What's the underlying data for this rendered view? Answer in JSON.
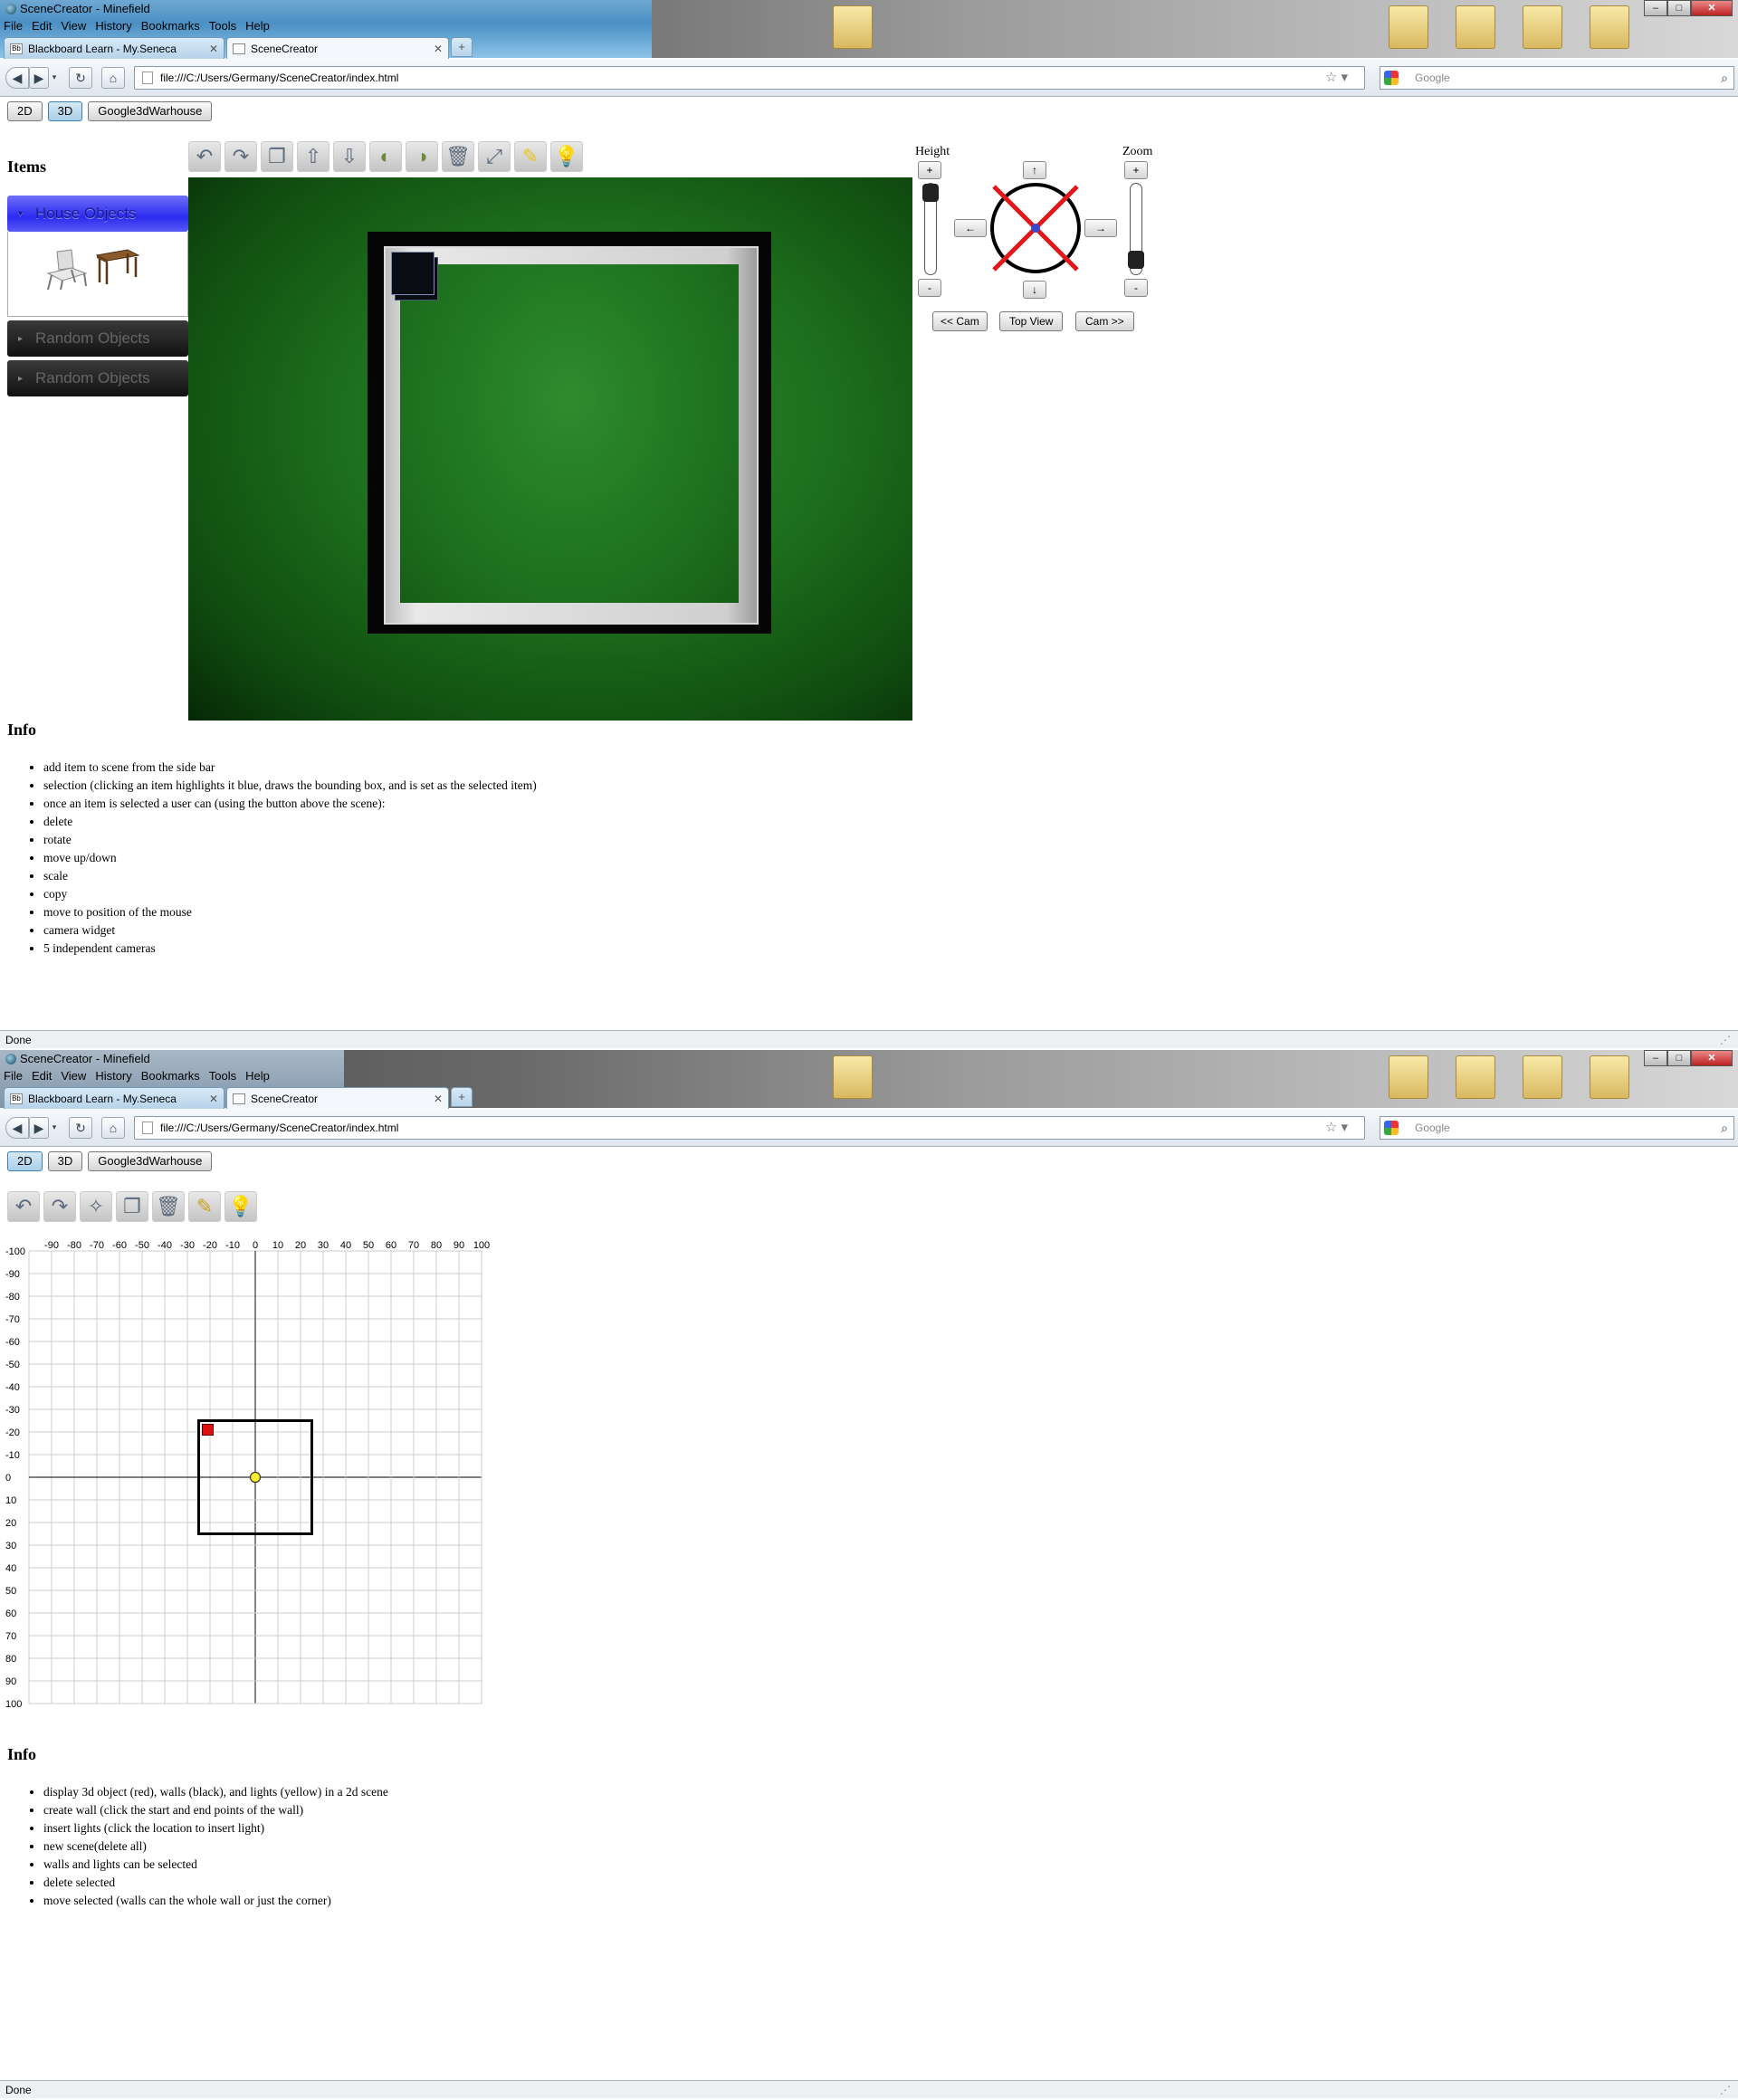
{
  "window1": {
    "app_title": "SceneCreator - Minefield",
    "menu": [
      "File",
      "Edit",
      "View",
      "History",
      "Bookmarks",
      "Tools",
      "Help"
    ],
    "tabs": [
      {
        "label": "Blackboard Learn - My.Seneca",
        "icon": "Bb"
      },
      {
        "label": "SceneCreator"
      }
    ],
    "new_tab": "+",
    "url": "file:///C:/Users/Germany/SceneCreator/index.html",
    "search_placeholder": "Google",
    "status": "Done",
    "buttons": {
      "b2d": "2D",
      "b3d": "3D",
      "warehouse": "Google3dWarhouse",
      "active": "3D"
    },
    "items_heading": "Items",
    "accordion": [
      {
        "label": "House Objects",
        "state": "open",
        "arrow": "▾"
      },
      {
        "label": "Random Objects",
        "state": "closed",
        "arrow": "▸"
      },
      {
        "label": "Random Objects",
        "state": "closed",
        "arrow": "▸"
      }
    ],
    "toolbar_icons": [
      "undo-icon",
      "redo-icon",
      "copy-icon",
      "move-up-icon",
      "move-down-icon",
      "rotate-left-icon",
      "rotate-right-icon",
      "delete-icon",
      "scale-icon",
      "add-light-icon",
      "light-icon"
    ],
    "camera": {
      "height_label": "Height",
      "zoom_label": "Zoom",
      "plus": "+",
      "minus": "-",
      "up": "↑",
      "down": "↓",
      "left": "←",
      "right": "→",
      "prev_cam": "<< Cam",
      "top_view": "Top View",
      "next_cam": "Cam >>",
      "height_level": 1.0,
      "zoom_level": 0.1
    },
    "info_heading": "Info",
    "info": [
      "add item to scene from the side bar",
      "selection (clicking an item highlights it blue, draws the bounding box, and is set as the selected item)",
      "once an item is selected a user can (using the button above the scene):"
    ],
    "info_sub": [
      "delete",
      "rotate",
      "move up/down",
      "scale",
      "copy",
      "move to position of the mouse"
    ],
    "info_after": [
      "camera widget",
      "5 independent cameras"
    ]
  },
  "window2": {
    "app_title": "SceneCreator - Minefield",
    "menu": [
      "File",
      "Edit",
      "View",
      "History",
      "Bookmarks",
      "Tools",
      "Help"
    ],
    "tabs": [
      {
        "label": "Blackboard Learn - My.Seneca",
        "icon": "Bb"
      },
      {
        "label": "SceneCreator"
      }
    ],
    "new_tab": "+",
    "url": "file:///C:/Users/Germany/SceneCreator/index.html",
    "search_placeholder": "Google",
    "status": "Done",
    "buttons": {
      "b2d": "2D",
      "b3d": "3D",
      "warehouse": "Google3dWarhouse",
      "active": "2D"
    },
    "toolbar_icons": [
      "undo-icon",
      "redo-icon",
      "new-scene-icon",
      "copy-icon",
      "delete-icon",
      "draw-wall-icon",
      "insert-light-icon"
    ],
    "grid": {
      "x_ticks": [
        "-90",
        "-80",
        "-70",
        "-60",
        "-50",
        "-40",
        "-30",
        "-20",
        "-10",
        "0",
        "10",
        "20",
        "30",
        "40",
        "50",
        "60",
        "70",
        "80",
        "90",
        "100"
      ],
      "y_ticks": [
        "-100",
        "-90",
        "-80",
        "-70",
        "-60",
        "-50",
        "-40",
        "-30",
        "-20",
        "-10",
        "0",
        "10",
        "20",
        "30",
        "40",
        "50",
        "60",
        "70",
        "80",
        "90",
        "100"
      ],
      "walls": [
        [
          -25,
          -25
        ],
        [
          25,
          -25
        ],
        [
          25,
          25
        ],
        [
          -25,
          25
        ]
      ],
      "object": {
        "x": -21,
        "y": -21,
        "color": "#dd1111"
      },
      "light": {
        "x": 0,
        "y": 0,
        "color": "#ffee33"
      }
    },
    "info_heading": "Info",
    "info": [
      "display 3d object (red), walls (black), and lights (yellow) in a 2d scene",
      "create wall (click the start and end points of the wall)",
      "insert lights (click the location to insert light)",
      "new scene(delete all)",
      "walls and lights can be selected",
      "delete selected",
      "move selected (walls can the whole wall or just the corner)"
    ]
  }
}
